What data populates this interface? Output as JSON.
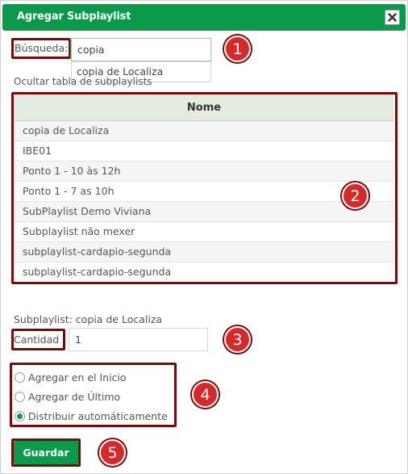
{
  "dialog": {
    "title": "Agregar Subplaylist",
    "close_icon": "close-icon"
  },
  "search": {
    "label": "Búsqueda:",
    "value": "copia",
    "suggestion": "copia de Localiza"
  },
  "toggle_table_link": "Ocultar tabla de subplaylists",
  "table": {
    "header": "Nome",
    "rows": [
      "copia de Localiza",
      "IBE01",
      "Ponto 1 - 10 às 12h",
      "Ponto 1 - 7 as 10h",
      "SubPlaylist Demo Viviana",
      "Subplaylist não mexer",
      "subplaylist-cardapio-segunda",
      "subplaylist-cardapio-segunda"
    ]
  },
  "selected_subplaylist": "Subplaylist: copia de Localiza",
  "quantity": {
    "label": "Cantidad",
    "value": "1"
  },
  "options": [
    {
      "label": "Agregar en el Inicio",
      "checked": false
    },
    {
      "label": "Agregar de Último",
      "checked": false
    },
    {
      "label": "Distribuir automáticamente",
      "checked": true
    }
  ],
  "save_label": "Guardar",
  "badges": [
    "1",
    "2",
    "3",
    "4",
    "5"
  ],
  "colors": {
    "accent": "#0b9a4a",
    "annotation_border": "#7a0b0b",
    "badge": "#d62a2a"
  }
}
